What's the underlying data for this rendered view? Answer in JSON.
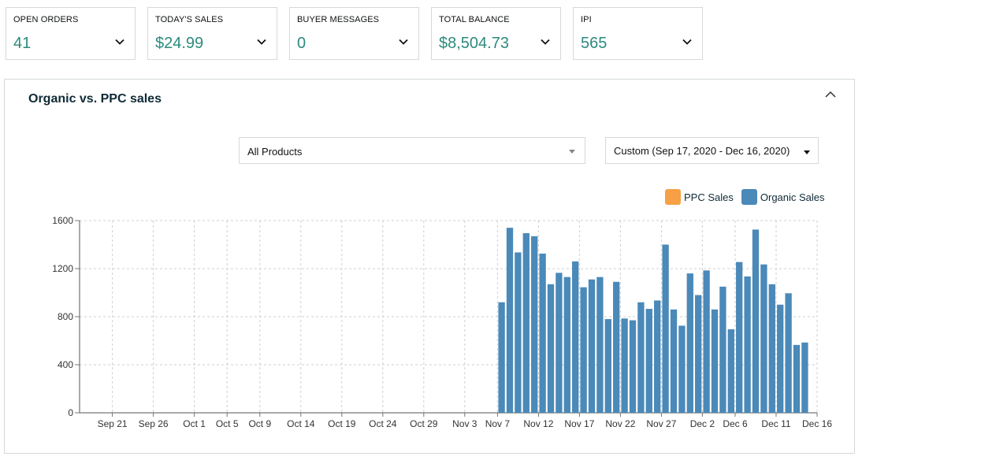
{
  "cards": [
    {
      "label": "OPEN ORDERS",
      "value": "41"
    },
    {
      "label": "TODAY'S SALES",
      "value": "$24.99"
    },
    {
      "label": "BUYER MESSAGES",
      "value": "0"
    },
    {
      "label": "TOTAL BALANCE",
      "value": "$8,504.73"
    },
    {
      "label": "IPI",
      "value": "565"
    }
  ],
  "panel": {
    "title": "Organic vs. PPC sales",
    "product_select": "All Products",
    "date_select": "Custom (Sep 17, 2020 - Dec 16, 2020)"
  },
  "colors": {
    "accent_value": "#2d8a7e",
    "ppc": "#f7a045",
    "organic": "#4a89b8"
  },
  "chart_data": {
    "type": "bar",
    "title": "",
    "xlabel": "",
    "ylabel": "",
    "ylim": [
      0,
      1600
    ],
    "yticks": [
      0,
      400,
      800,
      1200,
      1600
    ],
    "x_start": "2020-09-17",
    "x_end": "2020-12-16",
    "xtick_labels": [
      "Sep 21",
      "Sep 26",
      "Oct 1",
      "Oct 5",
      "Oct 9",
      "Oct 14",
      "Oct 19",
      "Oct 24",
      "Oct 29",
      "Nov 3",
      "Nov 7",
      "Nov 12",
      "Nov 17",
      "Nov 22",
      "Nov 27",
      "Dec 2",
      "Dec 6",
      "Dec 11",
      "Dec 16"
    ],
    "xtick_dates": [
      "2020-09-21",
      "2020-09-26",
      "2020-10-01",
      "2020-10-05",
      "2020-10-09",
      "2020-10-14",
      "2020-10-19",
      "2020-10-24",
      "2020-10-29",
      "2020-11-03",
      "2020-11-07",
      "2020-11-12",
      "2020-11-17",
      "2020-11-22",
      "2020-11-27",
      "2020-12-02",
      "2020-12-06",
      "2020-12-11",
      "2020-12-16"
    ],
    "grid": true,
    "legend_position": "top-right",
    "series": [
      {
        "name": "PPC Sales",
        "color": "#f7a045",
        "values": []
      },
      {
        "name": "Organic Sales",
        "color": "#4a89b8",
        "dates": [
          "2020-11-07",
          "2020-11-08",
          "2020-11-09",
          "2020-11-10",
          "2020-11-11",
          "2020-11-12",
          "2020-11-13",
          "2020-11-14",
          "2020-11-15",
          "2020-11-16",
          "2020-11-17",
          "2020-11-18",
          "2020-11-19",
          "2020-11-20",
          "2020-11-21",
          "2020-11-22",
          "2020-11-23",
          "2020-11-24",
          "2020-11-25",
          "2020-11-26",
          "2020-11-27",
          "2020-11-28",
          "2020-11-29",
          "2020-11-30",
          "2020-12-01",
          "2020-12-02",
          "2020-12-03",
          "2020-12-04",
          "2020-12-05",
          "2020-12-06",
          "2020-12-07",
          "2020-12-08",
          "2020-12-09",
          "2020-12-10",
          "2020-12-11",
          "2020-12-12",
          "2020-12-13",
          "2020-12-14",
          "2020-12-15"
        ],
        "values": [
          920,
          1540,
          1335,
          1495,
          1470,
          1325,
          1070,
          1165,
          1130,
          1260,
          1045,
          1110,
          1130,
          780,
          1090,
          785,
          770,
          920,
          865,
          935,
          1400,
          860,
          725,
          1160,
          980,
          1185,
          860,
          1050,
          695,
          1255,
          1135,
          1525,
          1235,
          1070,
          900,
          995,
          565,
          585,
          0
        ]
      }
    ]
  }
}
